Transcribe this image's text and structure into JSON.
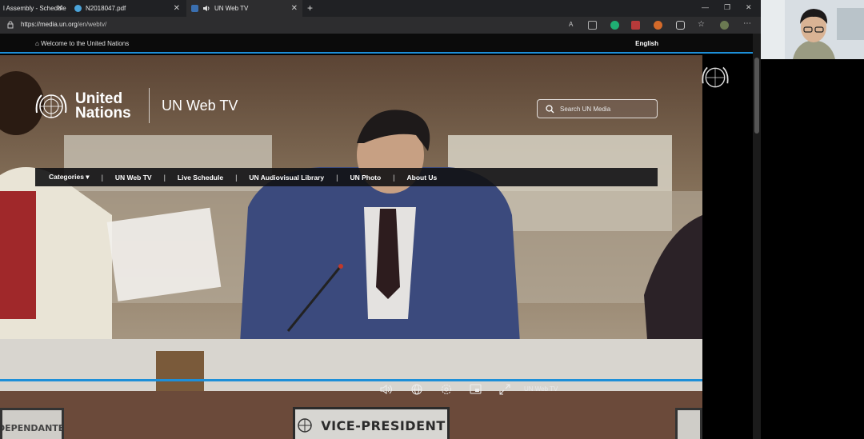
{
  "browser": {
    "tabs": [
      {
        "label": "l Assembly - Schedule",
        "active": false
      },
      {
        "label": "N2018047.pdf",
        "active": false
      },
      {
        "label": "UN Web TV",
        "active": true
      }
    ],
    "url_host": "https://media.un.org",
    "url_path": "/en/webtv/"
  },
  "site": {
    "welcome": "Welcome to the United Nations",
    "language": "English",
    "org_line1": "United",
    "org_line2": "Nations",
    "section_title": "UN Web TV",
    "search_placeholder": "Search UN Media",
    "nav": [
      {
        "label": "Categories ▾"
      },
      {
        "label": "UN Web TV"
      },
      {
        "label": "Live Schedule"
      },
      {
        "label": "UN Audiovisual Library"
      },
      {
        "label": "UN Photo"
      },
      {
        "label": "About Us"
      }
    ]
  },
  "video": {
    "nameplate": "VICE-PRESIDENT",
    "nameplate_left": "DEPENDANTE",
    "controls_label": "UN Web TV",
    "progress": 1.0
  },
  "colors": {
    "accent": "#1d8fd8"
  }
}
